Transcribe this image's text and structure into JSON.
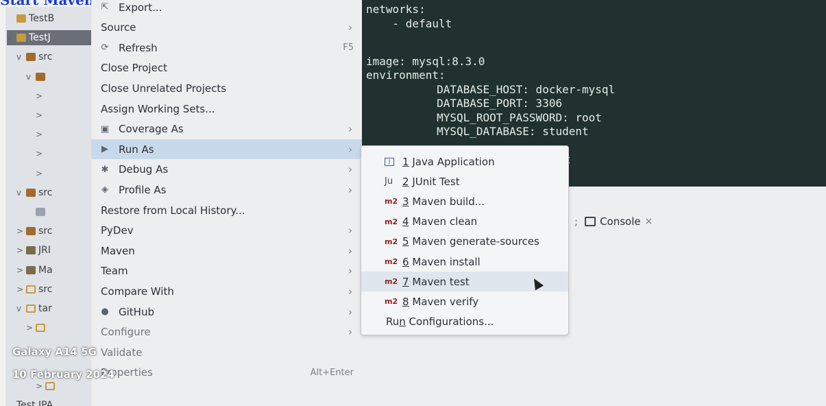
{
  "caption": "Start Maven to upload goes in the system",
  "explorer": {
    "items": [
      {
        "arrow": "",
        "label": "TestB",
        "icon": "folder"
      },
      {
        "arrow": "v",
        "label": "TestJ",
        "icon": "project"
      },
      {
        "arrow": "v",
        "label": "src",
        "icon": "pkg"
      },
      {
        "arrow": "v",
        "label": "",
        "icon": "pkg"
      },
      {
        "arrow": ">",
        "label": "",
        "icon": ""
      },
      {
        "arrow": ">",
        "label": "",
        "icon": ""
      },
      {
        "arrow": ">",
        "label": "",
        "icon": ""
      },
      {
        "arrow": ">",
        "label": "",
        "icon": ""
      },
      {
        "arrow": ">",
        "label": "",
        "icon": ""
      },
      {
        "arrow": "v",
        "label": "src",
        "icon": "pkg"
      },
      {
        "arrow": "",
        "label": "",
        "icon": "file"
      },
      {
        "arrow": ">",
        "label": "src",
        "icon": "pkg"
      },
      {
        "arrow": ">",
        "label": "JRI",
        "icon": "lib"
      },
      {
        "arrow": ">",
        "label": "Ma",
        "icon": "lib"
      },
      {
        "arrow": ">",
        "label": "src",
        "icon": "open"
      },
      {
        "arrow": "v",
        "label": "tar",
        "icon": "open"
      },
      {
        "arrow": ">",
        "label": "",
        "icon": "open"
      },
      {
        "arrow": "",
        "label": "",
        "icon": ""
      },
      {
        "arrow": "",
        "label": "",
        "icon": ""
      },
      {
        "arrow": ">",
        "label": "",
        "icon": "open"
      },
      {
        "arrow": "",
        "label": "Test JPA",
        "icon": ""
      }
    ]
  },
  "context_menu": {
    "items": [
      {
        "label": "Export...",
        "icon": "export-icon",
        "glyph": "⇱",
        "submenu": false,
        "key": ""
      },
      {
        "label": "Source",
        "icon": "",
        "glyph": "",
        "submenu": true,
        "key": ""
      },
      {
        "label": "Refresh",
        "icon": "refresh-icon",
        "glyph": "⟳",
        "submenu": false,
        "key": "F5"
      },
      {
        "label": "Close Project",
        "icon": "",
        "glyph": "",
        "submenu": false,
        "key": ""
      },
      {
        "label": "Close Unrelated Projects",
        "icon": "",
        "glyph": "",
        "submenu": false,
        "key": ""
      },
      {
        "label": "Assign Working Sets...",
        "icon": "",
        "glyph": "",
        "submenu": false,
        "key": ""
      },
      {
        "label": "Coverage As",
        "icon": "coverage-icon",
        "glyph": "▣",
        "submenu": true,
        "key": ""
      },
      {
        "label": "Run As",
        "icon": "run-icon",
        "glyph": "▶",
        "submenu": true,
        "key": ""
      },
      {
        "label": "Debug As",
        "icon": "debug-icon",
        "glyph": "✱",
        "submenu": true,
        "key": ""
      },
      {
        "label": "Profile As",
        "icon": "profile-icon",
        "glyph": "◈",
        "submenu": true,
        "key": ""
      },
      {
        "label": "Restore from Local History...",
        "icon": "",
        "glyph": "",
        "submenu": false,
        "key": ""
      },
      {
        "label": "PyDev",
        "icon": "",
        "glyph": "",
        "submenu": true,
        "key": ""
      },
      {
        "label": "Maven",
        "icon": "",
        "glyph": "",
        "submenu": true,
        "key": ""
      },
      {
        "label": "Team",
        "icon": "",
        "glyph": "",
        "submenu": true,
        "key": ""
      },
      {
        "label": "Compare With",
        "icon": "",
        "glyph": "",
        "submenu": true,
        "key": ""
      },
      {
        "label": "GitHub",
        "icon": "github-icon",
        "glyph": "●",
        "submenu": true,
        "key": ""
      },
      {
        "label": "Configure",
        "icon": "",
        "glyph": "",
        "submenu": true,
        "key": ""
      },
      {
        "label": "Validate",
        "icon": "",
        "glyph": "",
        "submenu": false,
        "key": ""
      },
      {
        "label": "Properties",
        "icon": "",
        "glyph": "",
        "submenu": false,
        "key": "Alt+Enter"
      }
    ]
  },
  "editor": {
    "lines": [
      "networks:",
      "    - default",
      "",
      "image: mysql:8.3.0",
      "environment:",
      "        DATABASE_HOST: docker-mysql",
      "        DATABASE_PORT: 3306",
      "        MYSQL_ROOT_PASSWORD: root",
      "        MYSQL_DATABASE: student",
      "",
      "                            oot"
    ]
  },
  "console_tab": {
    "label": "Console",
    "close": "×"
  },
  "run_as_submenu": {
    "items": [
      {
        "num": "1",
        "text": " Java Application",
        "icon": "java-app-icon",
        "badge": "J"
      },
      {
        "num": "2",
        "text": " JUnit Test",
        "icon": "junit-icon",
        "badge": "Ju"
      },
      {
        "num": "3",
        "text": " Maven build...",
        "icon": "maven-icon",
        "badge": "m2"
      },
      {
        "num": "4",
        "text": " Maven clean",
        "icon": "maven-icon",
        "badge": "m2"
      },
      {
        "num": "5",
        "text": " Maven generate-sources",
        "icon": "maven-icon",
        "badge": "m2"
      },
      {
        "num": "6",
        "text": " Maven install",
        "icon": "maven-icon",
        "badge": "m2"
      },
      {
        "num": "7",
        "text": " Maven test",
        "icon": "maven-icon",
        "badge": "m2"
      },
      {
        "num": "8",
        "text": " Maven verify",
        "icon": "maven-icon",
        "badge": "m2"
      }
    ],
    "run_configurations": {
      "before": "Ru",
      "underlined": "n",
      "after": " Configurations..."
    }
  },
  "watermark": {
    "device": "Galaxy A14 5G",
    "date": "10 February 2024"
  },
  "colors": {
    "editor_bg": "#20312f",
    "menu_highlight": "#c9d9ec",
    "maven_badge": "#8a1f1f"
  }
}
